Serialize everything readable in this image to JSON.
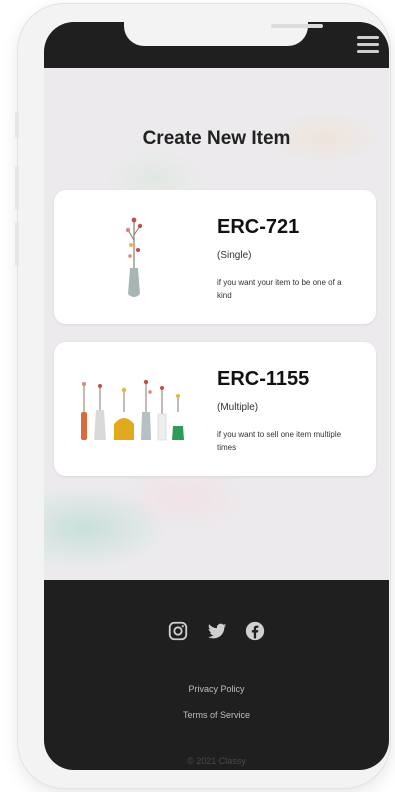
{
  "page": {
    "title": "Create New Item"
  },
  "header": {
    "menu_icon": "hamburger-menu-icon"
  },
  "cards": [
    {
      "name": "ERC-721",
      "type": "(Single)",
      "description": "if you want your item to be one of a kind",
      "illustration": "single-vase"
    },
    {
      "name": "ERC-1155",
      "type": "(Multiple)",
      "description": "if you want to sell one item multiple times",
      "illustration": "multiple-vases"
    }
  ],
  "footer": {
    "social_icons": [
      "instagram-icon",
      "twitter-icon",
      "facebook-icon"
    ],
    "privacy_label": "Privacy Policy",
    "terms_label": "Terms of Service",
    "copyright": "© 2021 Classy"
  },
  "colors": {
    "header_bg": "#1f1f1f",
    "footer_bg": "#1f1f1f",
    "card_bg": "#ffffff",
    "page_bg": "#eceaec"
  }
}
